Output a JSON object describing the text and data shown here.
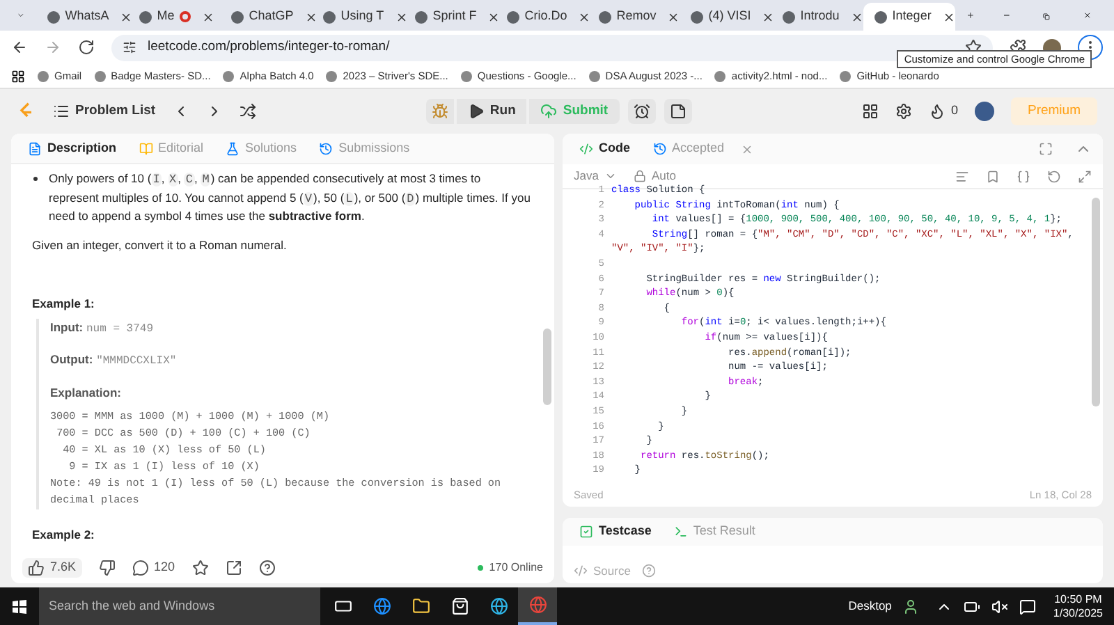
{
  "browser": {
    "tabs": [
      {
        "title": "WhatsA",
        "selected": false,
        "recording": false
      },
      {
        "title": "Me",
        "selected": false,
        "recording": true
      },
      {
        "title": "ChatGP",
        "selected": false,
        "recording": false
      },
      {
        "title": "Using T",
        "selected": false,
        "recording": false
      },
      {
        "title": "Sprint F",
        "selected": false,
        "recording": false
      },
      {
        "title": "Crio.Do",
        "selected": false,
        "recording": false
      },
      {
        "title": "Remov",
        "selected": false,
        "recording": false
      },
      {
        "title": "(4) VISI",
        "selected": false,
        "recording": false
      },
      {
        "title": "Introdu",
        "selected": false,
        "recording": false
      },
      {
        "title": "Integer",
        "selected": true,
        "recording": false
      }
    ],
    "address": "leetcode.com/problems/integer-to-roman/",
    "tooltip": "Customize and control Google Chrome",
    "bookmarks": [
      "Gmail",
      "Badge Masters- SD...",
      "Alpha Batch 4.0",
      "2023 – Striver's SDE...",
      "Questions - Google...",
      "DSA August 2023 -...",
      "activity2.html - nod...",
      "GitHub - leonardo"
    ]
  },
  "header": {
    "title": "Problem List",
    "run": "Run",
    "submit": "Submit",
    "streak": "0",
    "premium": "Premium"
  },
  "description_panel": {
    "tabs": [
      {
        "label": "Description",
        "selected": true
      },
      {
        "label": "Editorial",
        "selected": false
      },
      {
        "label": "Solutions",
        "selected": false
      },
      {
        "label": "Submissions",
        "selected": false
      }
    ],
    "bullet": [
      {
        "kind": "text",
        "text": "Only powers of 10 ("
      },
      {
        "kind": "code",
        "text": "I"
      },
      {
        "kind": "text",
        "text": ", "
      },
      {
        "kind": "code",
        "text": "X"
      },
      {
        "kind": "text",
        "text": ", "
      },
      {
        "kind": "code",
        "text": "C"
      },
      {
        "kind": "text",
        "text": ", "
      },
      {
        "kind": "code",
        "text": "M"
      },
      {
        "kind": "text",
        "text": ") can be appended consecutively at most 3 times to represent multiples of 10. You cannot append 5 ("
      },
      {
        "kind": "code",
        "text": "V"
      },
      {
        "kind": "text",
        "text": "), 50 ("
      },
      {
        "kind": "code",
        "text": "L"
      },
      {
        "kind": "text",
        "text": "), or 500 ("
      },
      {
        "kind": "code",
        "text": "D"
      },
      {
        "kind": "text",
        "text": ") multiple times. If you need to append a symbol 4 times use the "
      },
      {
        "kind": "bold",
        "text": "subtractive form"
      },
      {
        "kind": "text",
        "text": "."
      }
    ],
    "task": "Given an integer, convert it to a Roman numeral.",
    "example": {
      "title": "Example 1:",
      "input_label": "Input:",
      "input": "num = 3749",
      "output_label": "Output:",
      "output": "\"MMMDCCXLIX\"",
      "explanation_label": "Explanation:",
      "explanation": [
        "3000 = MMM as 1000 (M) + 1000 (M) + 1000 (M)",
        " 700 = DCC as 500 (D) + 100 (C) + 100 (C)",
        "  40 = XL as 10 (X) less of 50 (L)",
        "   9 = IX as 1 (I) less of 10 (X)",
        "Note: 49 is not 1 (I) less of 50 (L) because the conversion is based on decimal places"
      ]
    },
    "next_example": "Example 2:",
    "likes": "7.6K",
    "comments": "120",
    "online": "170 Online"
  },
  "code_panel": {
    "tabs": [
      {
        "label": "Code",
        "selected": true
      },
      {
        "label": "Accepted",
        "selected": false
      }
    ],
    "language": "Java",
    "mode": "Auto",
    "lines": [
      {
        "num": "1",
        "segments": [
          {
            "kind": "kw",
            "text": "class"
          },
          {
            "kind": "plain",
            "text": " Solution {"
          }
        ]
      },
      {
        "num": "2",
        "segments": [
          {
            "kind": "kw",
            "text": "    public String"
          },
          {
            "kind": "plain",
            "text": " intToRoman("
          },
          {
            "kind": "kw",
            "text": "int"
          },
          {
            "kind": "plain",
            "text": " num) {"
          }
        ]
      },
      {
        "num": "3",
        "segments": [
          {
            "kind": "kw",
            "text": "       int"
          },
          {
            "kind": "plain",
            "text": " values[] = {"
          },
          {
            "kind": "num",
            "text": "1000, 900, 500, 400, 100, 90, 50, 40, 10, 9, 5, 4, 1"
          },
          {
            "kind": "plain",
            "text": "};"
          }
        ]
      },
      {
        "num": "4",
        "segments": [
          {
            "kind": "kw",
            "text": "       String"
          },
          {
            "kind": "plain",
            "text": "[] roman = {"
          },
          {
            "kind": "str",
            "text": "\"M\", \"CM\", \"D\", \"CD\", \"C\", \"XC\", \"L\", \"XL\", \"X\", \"IX\""
          },
          {
            "kind": "plain",
            "text": ","
          }
        ]
      },
      {
        "segments": [
          {
            "kind": "str",
            "text": "\"V\", \"IV\", \"I\""
          },
          {
            "kind": "plain",
            "text": "};"
          }
        ]
      },
      {
        "num": "5"
      },
      {
        "num": "6",
        "segments": [
          {
            "kind": "plain",
            "text": "      StringBuilder res = "
          },
          {
            "kind": "kw",
            "text": "new"
          },
          {
            "kind": "plain",
            "text": " StringBuilder();"
          }
        ]
      },
      {
        "num": "7",
        "segments": [
          {
            "kind": "ctrl",
            "text": "      while"
          },
          {
            "kind": "plain",
            "text": "(num > "
          },
          {
            "kind": "num",
            "text": "0"
          },
          {
            "kind": "plain",
            "text": "){"
          }
        ]
      },
      {
        "num": "8",
        "segments": [
          {
            "kind": "plain",
            "text": "         {"
          }
        ]
      },
      {
        "num": "9",
        "segments": [
          {
            "kind": "ctrl",
            "text": "            for"
          },
          {
            "kind": "plain",
            "text": "("
          },
          {
            "kind": "kw",
            "text": "int"
          },
          {
            "kind": "plain",
            "text": " i="
          },
          {
            "kind": "num",
            "text": "0"
          },
          {
            "kind": "plain",
            "text": "; i< values.length;i++){"
          }
        ]
      },
      {
        "num": "10",
        "segments": [
          {
            "kind": "ctrl",
            "text": "                if"
          },
          {
            "kind": "plain",
            "text": "(num >= values[i]){"
          }
        ]
      },
      {
        "num": "11",
        "segments": [
          {
            "kind": "plain",
            "text": "                    res."
          },
          {
            "kind": "fn",
            "text": "append"
          },
          {
            "kind": "plain",
            "text": "(roman[i]);"
          }
        ]
      },
      {
        "num": "12",
        "segments": [
          {
            "kind": "plain",
            "text": "                    num -= values[i];"
          }
        ]
      },
      {
        "num": "13",
        "segments": [
          {
            "kind": "ctrl",
            "text": "                    break"
          },
          {
            "kind": "plain",
            "text": ";"
          }
        ]
      },
      {
        "num": "14",
        "segments": [
          {
            "kind": "plain",
            "text": "                }"
          }
        ]
      },
      {
        "num": "15",
        "segments": [
          {
            "kind": "plain",
            "text": "            }"
          }
        ]
      },
      {
        "num": "16",
        "segments": [
          {
            "kind": "plain",
            "text": "        }"
          }
        ]
      },
      {
        "num": "17",
        "segments": [
          {
            "kind": "plain",
            "text": "      }"
          }
        ]
      },
      {
        "num": "18",
        "segments": [
          {
            "kind": "ctrl",
            "text": "     return"
          },
          {
            "kind": "plain",
            "text": " res."
          },
          {
            "kind": "fn",
            "text": "toString"
          },
          {
            "kind": "plain",
            "text": "();"
          }
        ]
      },
      {
        "num": "19",
        "segments": [
          {
            "kind": "plain",
            "text": "    }"
          }
        ]
      }
    ],
    "status": "Saved",
    "cursor": "Ln 18, Col 28"
  },
  "test_panel": {
    "tabs": [
      {
        "label": "Testcase",
        "selected": true
      },
      {
        "label": "Test Result",
        "selected": false
      }
    ],
    "source": "Source"
  },
  "taskbar": {
    "search": "Search the web and Windows",
    "apps": [
      {
        "kind": "taskview",
        "active": false
      },
      {
        "kind": "ie",
        "active": false
      },
      {
        "kind": "files",
        "active": false
      },
      {
        "kind": "store",
        "active": false
      },
      {
        "kind": "edge",
        "active": false
      },
      {
        "kind": "chrome",
        "active": true
      }
    ],
    "desktop": "Desktop",
    "time": "10:50 PM",
    "date": "1/30/2025"
  }
}
